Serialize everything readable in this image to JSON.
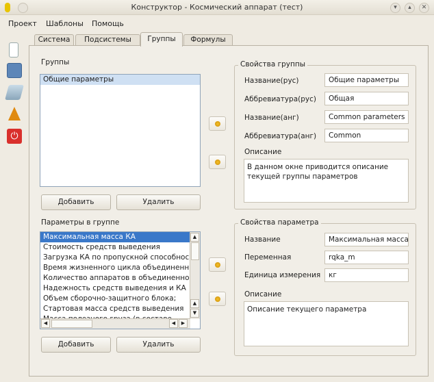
{
  "window": {
    "title": "Конструктор - Космический аппарат (тест)"
  },
  "menu": [
    "Проект",
    "Шаблоны",
    "Помощь"
  ],
  "tabs": [
    "Система",
    "Подсистемы",
    "Группы",
    "Формулы"
  ],
  "groups": {
    "label": "Группы",
    "items": [
      "Общие параметры"
    ],
    "add": "Добавить",
    "remove": "Удалить"
  },
  "params": {
    "label": "Параметры в группе",
    "items": [
      "Максимальная масса КА",
      "Стоимость средств выведения",
      "Загрузка КА по пропускной способнос",
      "Время жизненного цикла объединенн",
      "Количество аппаратов в объединенно",
      "Надежность средств выведения и КА",
      "Объем сборочно-защитного блока;",
      "Стартовая масса средств выведения",
      "Масса полезного груза (в составе"
    ],
    "add": "Добавить",
    "remove": "Удалить"
  },
  "group_props": {
    "title": "Свойства группы",
    "name_ru_label": "Название(рус)",
    "name_ru": "Общие параметры",
    "abbr_ru_label": "Аббревиатура(рус)",
    "abbr_ru": "Общая",
    "name_en_label": "Название(анг)",
    "name_en": "Common parameters",
    "abbr_en_label": "Аббревиатура(анг)",
    "abbr_en": "Common",
    "desc_label": "Описание",
    "desc": "В данном окне приводится описание текущей группы параметров"
  },
  "param_props": {
    "title": "Свойства параметра",
    "name_label": "Название",
    "name": "Максимальная масса",
    "var_label": "Переменная",
    "var": "rqka_m",
    "unit_label": "Единица измерения",
    "unit": "кг",
    "desc_label": "Описание",
    "desc": "Описание текущего параметра"
  }
}
